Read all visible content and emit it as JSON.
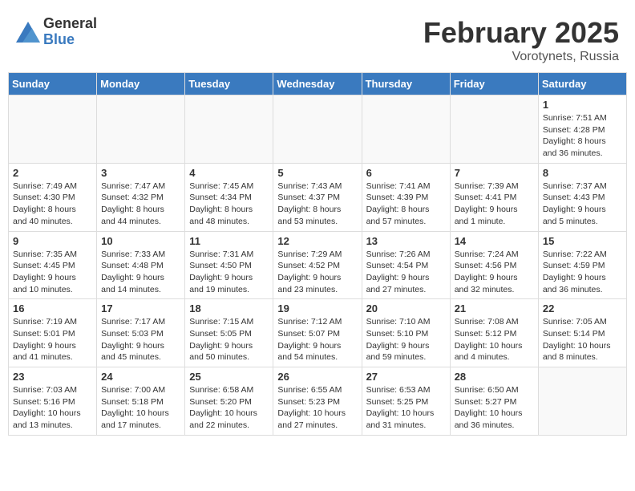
{
  "header": {
    "logo_general": "General",
    "logo_blue": "Blue",
    "month_title": "February 2025",
    "location": "Vorotynets, Russia"
  },
  "days_of_week": [
    "Sunday",
    "Monday",
    "Tuesday",
    "Wednesday",
    "Thursday",
    "Friday",
    "Saturday"
  ],
  "weeks": [
    [
      {
        "num": "",
        "info": ""
      },
      {
        "num": "",
        "info": ""
      },
      {
        "num": "",
        "info": ""
      },
      {
        "num": "",
        "info": ""
      },
      {
        "num": "",
        "info": ""
      },
      {
        "num": "",
        "info": ""
      },
      {
        "num": "1",
        "info": "Sunrise: 7:51 AM\nSunset: 4:28 PM\nDaylight: 8 hours and 36 minutes."
      }
    ],
    [
      {
        "num": "2",
        "info": "Sunrise: 7:49 AM\nSunset: 4:30 PM\nDaylight: 8 hours and 40 minutes."
      },
      {
        "num": "3",
        "info": "Sunrise: 7:47 AM\nSunset: 4:32 PM\nDaylight: 8 hours and 44 minutes."
      },
      {
        "num": "4",
        "info": "Sunrise: 7:45 AM\nSunset: 4:34 PM\nDaylight: 8 hours and 48 minutes."
      },
      {
        "num": "5",
        "info": "Sunrise: 7:43 AM\nSunset: 4:37 PM\nDaylight: 8 hours and 53 minutes."
      },
      {
        "num": "6",
        "info": "Sunrise: 7:41 AM\nSunset: 4:39 PM\nDaylight: 8 hours and 57 minutes."
      },
      {
        "num": "7",
        "info": "Sunrise: 7:39 AM\nSunset: 4:41 PM\nDaylight: 9 hours and 1 minute."
      },
      {
        "num": "8",
        "info": "Sunrise: 7:37 AM\nSunset: 4:43 PM\nDaylight: 9 hours and 5 minutes."
      }
    ],
    [
      {
        "num": "9",
        "info": "Sunrise: 7:35 AM\nSunset: 4:45 PM\nDaylight: 9 hours and 10 minutes."
      },
      {
        "num": "10",
        "info": "Sunrise: 7:33 AM\nSunset: 4:48 PM\nDaylight: 9 hours and 14 minutes."
      },
      {
        "num": "11",
        "info": "Sunrise: 7:31 AM\nSunset: 4:50 PM\nDaylight: 9 hours and 19 minutes."
      },
      {
        "num": "12",
        "info": "Sunrise: 7:29 AM\nSunset: 4:52 PM\nDaylight: 9 hours and 23 minutes."
      },
      {
        "num": "13",
        "info": "Sunrise: 7:26 AM\nSunset: 4:54 PM\nDaylight: 9 hours and 27 minutes."
      },
      {
        "num": "14",
        "info": "Sunrise: 7:24 AM\nSunset: 4:56 PM\nDaylight: 9 hours and 32 minutes."
      },
      {
        "num": "15",
        "info": "Sunrise: 7:22 AM\nSunset: 4:59 PM\nDaylight: 9 hours and 36 minutes."
      }
    ],
    [
      {
        "num": "16",
        "info": "Sunrise: 7:19 AM\nSunset: 5:01 PM\nDaylight: 9 hours and 41 minutes."
      },
      {
        "num": "17",
        "info": "Sunrise: 7:17 AM\nSunset: 5:03 PM\nDaylight: 9 hours and 45 minutes."
      },
      {
        "num": "18",
        "info": "Sunrise: 7:15 AM\nSunset: 5:05 PM\nDaylight: 9 hours and 50 minutes."
      },
      {
        "num": "19",
        "info": "Sunrise: 7:12 AM\nSunset: 5:07 PM\nDaylight: 9 hours and 54 minutes."
      },
      {
        "num": "20",
        "info": "Sunrise: 7:10 AM\nSunset: 5:10 PM\nDaylight: 9 hours and 59 minutes."
      },
      {
        "num": "21",
        "info": "Sunrise: 7:08 AM\nSunset: 5:12 PM\nDaylight: 10 hours and 4 minutes."
      },
      {
        "num": "22",
        "info": "Sunrise: 7:05 AM\nSunset: 5:14 PM\nDaylight: 10 hours and 8 minutes."
      }
    ],
    [
      {
        "num": "23",
        "info": "Sunrise: 7:03 AM\nSunset: 5:16 PM\nDaylight: 10 hours and 13 minutes."
      },
      {
        "num": "24",
        "info": "Sunrise: 7:00 AM\nSunset: 5:18 PM\nDaylight: 10 hours and 17 minutes."
      },
      {
        "num": "25",
        "info": "Sunrise: 6:58 AM\nSunset: 5:20 PM\nDaylight: 10 hours and 22 minutes."
      },
      {
        "num": "26",
        "info": "Sunrise: 6:55 AM\nSunset: 5:23 PM\nDaylight: 10 hours and 27 minutes."
      },
      {
        "num": "27",
        "info": "Sunrise: 6:53 AM\nSunset: 5:25 PM\nDaylight: 10 hours and 31 minutes."
      },
      {
        "num": "28",
        "info": "Sunrise: 6:50 AM\nSunset: 5:27 PM\nDaylight: 10 hours and 36 minutes."
      },
      {
        "num": "",
        "info": ""
      }
    ]
  ]
}
